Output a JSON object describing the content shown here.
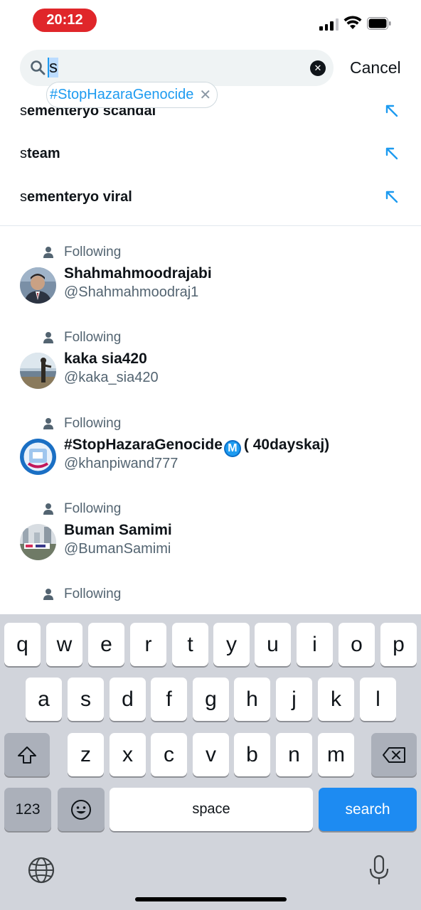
{
  "status_bar": {
    "time": "20:12",
    "accent_color": "#e0262a"
  },
  "search": {
    "query": "s",
    "cancel_label": "Cancel",
    "chip_label": "#StopHazaraGenocide",
    "chip_close": "✕",
    "clear_icon": "✕"
  },
  "suggestions": [
    {
      "prefix": "s",
      "rest": "ementeryo scandal",
      "icon": "arrow-up-left-icon"
    },
    {
      "prefix": "s",
      "rest": "team",
      "icon": "arrow-up-left-icon"
    },
    {
      "prefix": "s",
      "rest": "ementeryo viral",
      "icon": "arrow-up-left-icon"
    }
  ],
  "users": [
    {
      "status": "Following",
      "name": "Shahmahmoodrajabi",
      "handle": "@Shahmahmoodraj1"
    },
    {
      "status": "Following",
      "name": "kaka sia420",
      "handle": "@kaka_sia420"
    },
    {
      "status": "Following",
      "name": "#StopHazaraGenocide",
      "badge": "M",
      "name_suffix": "( 40dayskaj)",
      "handle": "@khanpiwand777"
    },
    {
      "status": "Following",
      "name": "Buman Samimi",
      "handle": "@BumanSamimi"
    },
    {
      "status": "Following",
      "name": "",
      "handle": ""
    }
  ],
  "keyboard": {
    "row1": [
      "q",
      "w",
      "e",
      "r",
      "t",
      "y",
      "u",
      "i",
      "o",
      "p"
    ],
    "row2": [
      "a",
      "s",
      "d",
      "f",
      "g",
      "h",
      "j",
      "k",
      "l"
    ],
    "row3": [
      "z",
      "x",
      "c",
      "v",
      "b",
      "n",
      "m"
    ],
    "k123": "123",
    "space": "space",
    "search": "search"
  },
  "colors": {
    "accent": "#1d9bf0",
    "search_key": "#1d8bf2",
    "keyboard_bg": "#d1d4db"
  }
}
